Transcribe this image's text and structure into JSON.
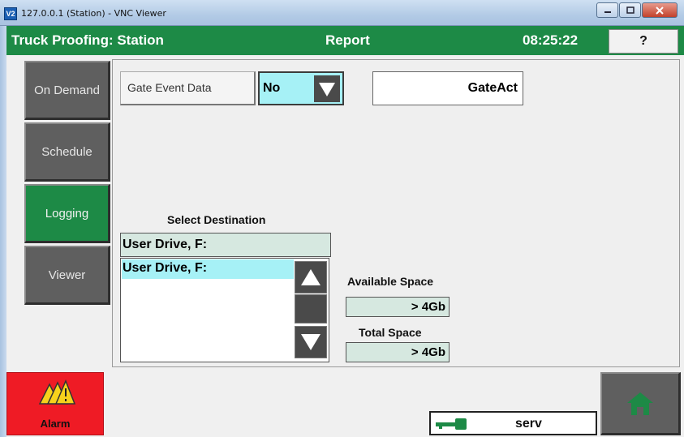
{
  "window": {
    "title": "127.0.0.1 (Station) - VNC Viewer",
    "logo_text": "V2",
    "minimize_icon": "minimize-icon",
    "maximize_icon": "maximize-icon",
    "close_icon": "close-icon"
  },
  "header": {
    "title": "Truck Proofing: Station",
    "page": "Report",
    "time": "08:25:22",
    "help_label": "?",
    "color": "#1d8a46"
  },
  "nav": {
    "items": [
      {
        "label": "On Demand",
        "active": false
      },
      {
        "label": "Schedule",
        "active": false
      },
      {
        "label": "Logging",
        "active": true
      },
      {
        "label": "Viewer",
        "active": false
      }
    ]
  },
  "gate": {
    "label": "Gate Event Data",
    "selected": "No",
    "dropdown_icon": "chevron-down-icon",
    "name": "GateAct"
  },
  "destination": {
    "title": "Select Destination",
    "current": "User Drive, F:",
    "options": [
      "User Drive, F:"
    ],
    "scroll_up_icon": "scroll-up-icon",
    "scroll_down_icon": "scroll-down-icon"
  },
  "space": {
    "available_label": "Available Space",
    "available_value": "> 4Gb",
    "total_label": "Total Space",
    "total_value": "> 4Gb"
  },
  "footer": {
    "alarm_label": "Alarm",
    "alarm_icon": "warning-icon",
    "alarm_color": "#ef1b25",
    "user_icon": "key-icon",
    "user": "serv",
    "home_icon": "home-icon"
  }
}
